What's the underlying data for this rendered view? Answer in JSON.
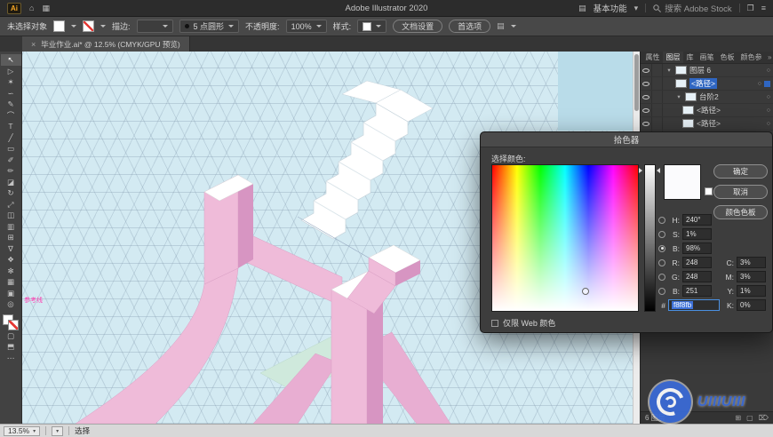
{
  "app": {
    "title": "Adobe Illustrator 2020",
    "workspace": "基本功能",
    "search": "搜索 Adobe Stock"
  },
  "control_bar": {
    "selection_status": "未选择对象",
    "stroke_label": "描边:",
    "brush_name": "5 点圆形",
    "opacity_label": "不透明度:",
    "opacity_value": "100%",
    "style_label": "样式:",
    "document_setup": "文档设置",
    "preferences": "首选项"
  },
  "document_tab": {
    "title": "毕业作业.ai* @ 12.5% (CMYK/GPU 预览)",
    "close": "×"
  },
  "toolbar": {
    "tools": [
      {
        "name": "selection-tool",
        "glyph": "↖"
      },
      {
        "name": "direct-selection-tool",
        "glyph": "▷"
      },
      {
        "name": "magic-wand-tool",
        "glyph": "✶"
      },
      {
        "name": "lasso-tool",
        "glyph": "∽"
      },
      {
        "name": "pen-tool",
        "glyph": "✎"
      },
      {
        "name": "curvature-tool",
        "glyph": "⌒"
      },
      {
        "name": "type-tool",
        "glyph": "T"
      },
      {
        "name": "line-segment-tool",
        "glyph": "╱"
      },
      {
        "name": "rectangle-tool",
        "glyph": "▭"
      },
      {
        "name": "paintbrush-tool",
        "glyph": "✐"
      },
      {
        "name": "pencil-tool",
        "glyph": "✏"
      },
      {
        "name": "eraser-tool",
        "glyph": "◪"
      },
      {
        "name": "rotate-tool",
        "glyph": "↻"
      },
      {
        "name": "scale-tool",
        "glyph": "⤢"
      },
      {
        "name": "shape-builder-tool",
        "glyph": "◫"
      },
      {
        "name": "gradient-tool",
        "glyph": "▥"
      },
      {
        "name": "mesh-tool",
        "glyph": "⊞"
      },
      {
        "name": "eyedropper-tool",
        "glyph": "∇"
      },
      {
        "name": "blend-tool",
        "glyph": "❖"
      },
      {
        "name": "symbol-sprayer-tool",
        "glyph": "✻"
      },
      {
        "name": "graph-tool",
        "glyph": "▦"
      },
      {
        "name": "artboard-tool",
        "glyph": "▣"
      },
      {
        "name": "zoom-tool",
        "glyph": "◎"
      }
    ]
  },
  "canvas": {
    "guide_label": "参考线"
  },
  "panel": {
    "tabs": [
      "属性",
      "图层",
      "库",
      "画笔",
      "色板",
      "颜色参"
    ],
    "layers": [
      {
        "name": "图层 6"
      },
      {
        "name": "<路径>"
      },
      {
        "name": "台阶2"
      },
      {
        "name": "<路径>"
      },
      {
        "name": "<路径>"
      },
      {
        "name": "<路径>"
      }
    ],
    "layer_count": "6 图层"
  },
  "color_picker": {
    "title": "拾色器",
    "select_label": "选择颜色:",
    "ok": "确定",
    "cancel": "取消",
    "swatches": "颜色色板",
    "web_only": "仅限 Web 颜色",
    "fields": {
      "h_label": "H:",
      "h": "240°",
      "s_label": "S:",
      "s": "1%",
      "b_label": "B:",
      "b": "98%",
      "r_label": "R:",
      "r": "248",
      "g_label": "G:",
      "g": "248",
      "b2_label": "B:",
      "b2": "251",
      "hex_label": "#",
      "hex": "f8f8fb",
      "c_label": "C:",
      "c": "3%",
      "m_label": "M:",
      "m": "3%",
      "y_label": "Y:",
      "y": "1%",
      "k_label": "K:",
      "k": "0%"
    }
  },
  "status_bar": {
    "zoom": "13.5%",
    "tool": "选择"
  },
  "watermark": {
    "text": "UIIIUIII"
  },
  "colors": {
    "accent": "#2f66c2",
    "canvas_bg": "#d3eaf2",
    "pink": "#efbbd9",
    "pink_dark": "#d795c2",
    "stripe_blue": "#5873a5"
  }
}
